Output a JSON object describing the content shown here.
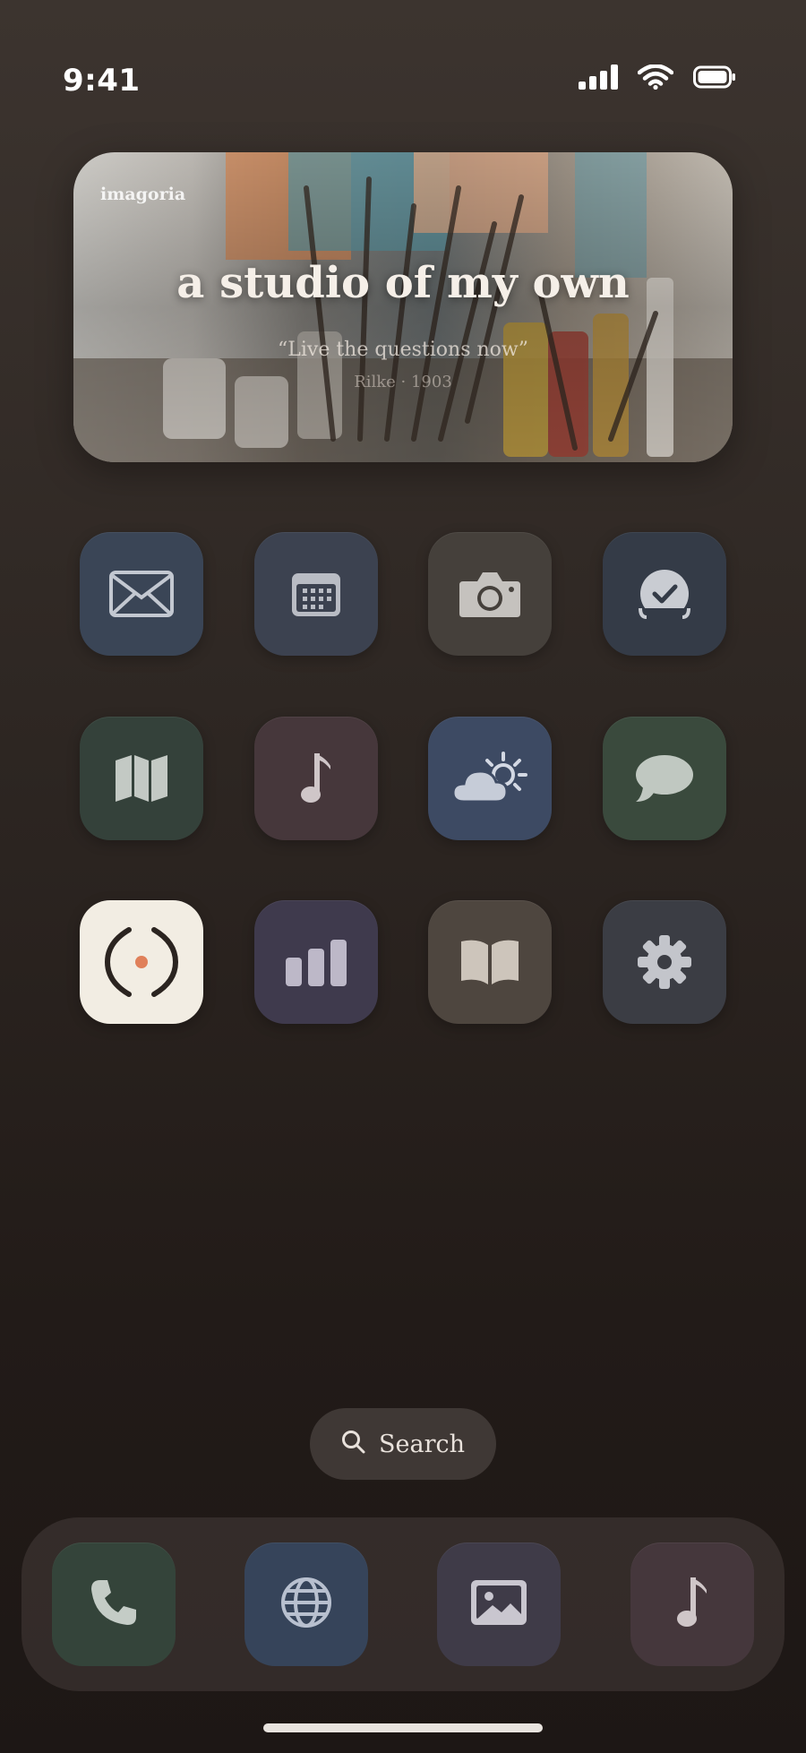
{
  "status_bar": {
    "time": "9:41",
    "icons": [
      "cellular-signal-icon",
      "wifi-icon",
      "battery-icon"
    ]
  },
  "widget": {
    "brand": "imagoria",
    "title": "a studio of my own",
    "quote": "“Live the questions now”",
    "author": "Rilke · 1903"
  },
  "apps": [
    {
      "icon": "mail-icon",
      "color": "#3a4556"
    },
    {
      "icon": "calendar-icon",
      "color": "#3c4250"
    },
    {
      "icon": "camera-icon",
      "color": "#45403b"
    },
    {
      "icon": "clock-icon",
      "color": "#343b47"
    },
    {
      "icon": "maps-icon",
      "color": "#34413a"
    },
    {
      "icon": "music-icon",
      "color": "#46373b"
    },
    {
      "icon": "weather-icon",
      "color": "#3d4a63"
    },
    {
      "icon": "messages-icon",
      "color": "#3a4a3d"
    },
    {
      "icon": "focus-app-icon",
      "color": "#f2ede3",
      "accent": "#e0805a"
    },
    {
      "icon": "stats-icon",
      "color": "#3f3a4d"
    },
    {
      "icon": "books-icon",
      "color": "#4e463f"
    },
    {
      "icon": "settings-icon",
      "color": "#3b3d44"
    }
  ],
  "search": {
    "label": "Search"
  },
  "dock": [
    {
      "icon": "phone-icon",
      "color": "#34443a"
    },
    {
      "icon": "browser-icon",
      "color": "#36445a"
    },
    {
      "icon": "photos-icon",
      "color": "#3f3b48"
    },
    {
      "icon": "music-icon",
      "color": "#45373c"
    }
  ]
}
